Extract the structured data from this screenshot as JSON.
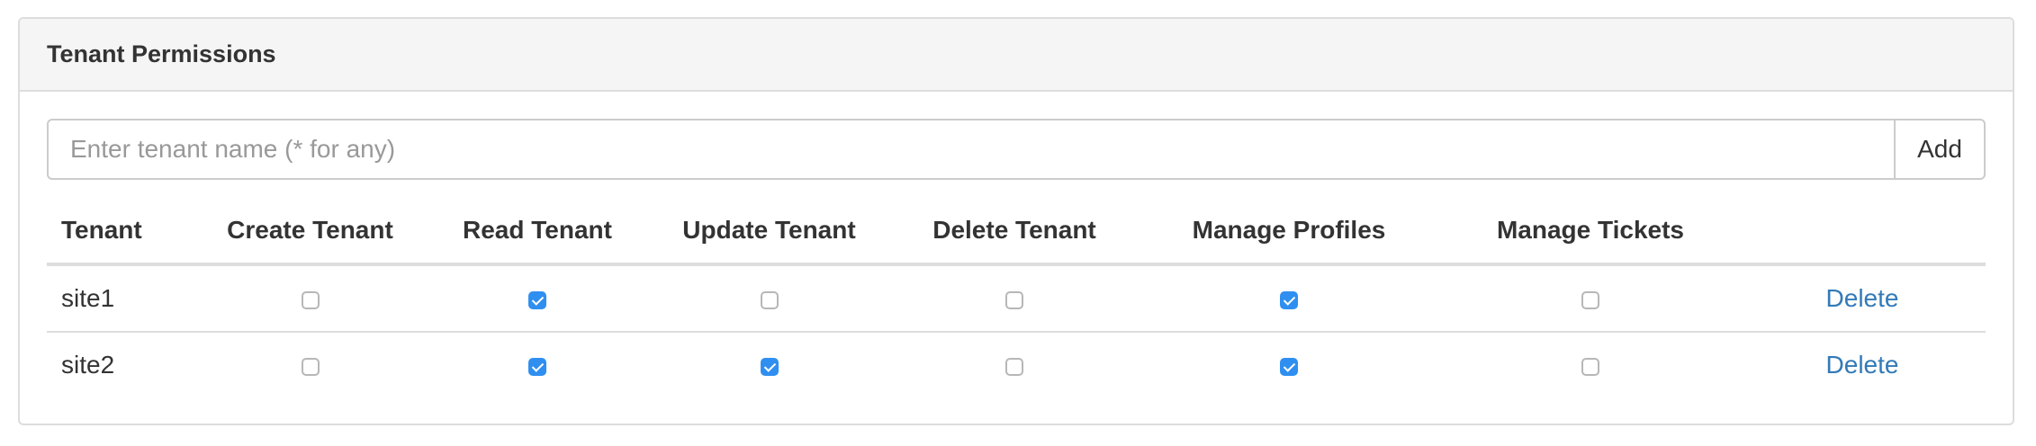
{
  "panel": {
    "title": "Tenant Permissions"
  },
  "form": {
    "placeholder": "Enter tenant name (* for any)",
    "value": "",
    "add_label": "Add"
  },
  "table": {
    "headers": [
      "Tenant",
      "Create Tenant",
      "Read Tenant",
      "Update Tenant",
      "Delete Tenant",
      "Manage Profiles",
      "Manage Tickets"
    ],
    "rows": [
      {
        "tenant": "site1",
        "create": false,
        "read": true,
        "update": false,
        "delete": false,
        "manage_profiles": true,
        "manage_tickets": false,
        "action_label": "Delete"
      },
      {
        "tenant": "site2",
        "create": false,
        "read": true,
        "update": true,
        "delete": false,
        "manage_profiles": true,
        "manage_tickets": false,
        "action_label": "Delete"
      }
    ]
  },
  "colors": {
    "accent": "#2f8ff0",
    "link": "#337ab7",
    "heading_bg": "#f5f5f5",
    "border": "#dddddd"
  }
}
